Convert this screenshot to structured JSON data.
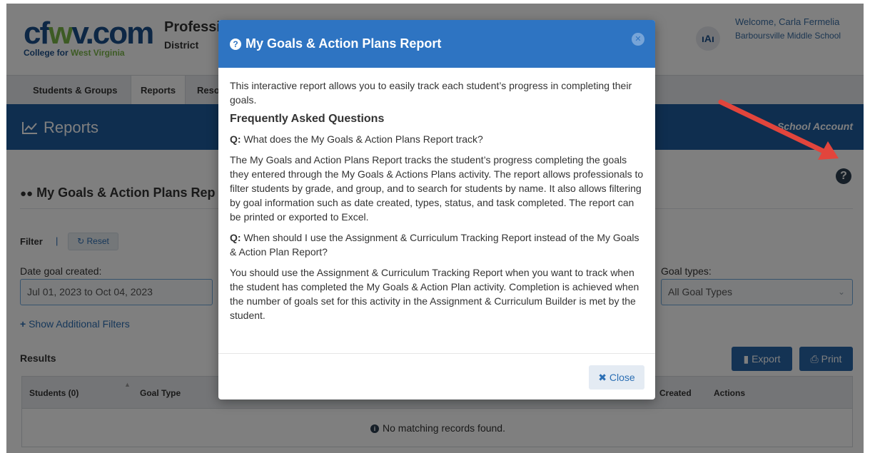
{
  "header": {
    "logo_main": "cfwv.com",
    "logo_sub": "College for West Virginia",
    "org_title": "Professi",
    "org_sub": "District",
    "user_initials": "ıAı",
    "welcome": "Welcome, Carla Fermelia",
    "school": "Barboursville Middle School"
  },
  "nav": {
    "items": [
      {
        "label": "Students & Groups"
      },
      {
        "label": "Reports"
      },
      {
        "label": "Reso"
      }
    ]
  },
  "banner": {
    "title": "Reports",
    "account": "School Account"
  },
  "section": {
    "title": "My Goals & Action Plans Rep"
  },
  "filters": {
    "label": "Filter",
    "separator": "|",
    "reset": "Reset",
    "date_label": "Date goal created:",
    "date_value": "Jul 01, 2023 to Oct 04, 2023",
    "goal_types_label": "Goal types:",
    "goal_types_value": "All Goal Types",
    "show_more": "Show Additional Filters"
  },
  "results": {
    "label": "Results",
    "export": "Export",
    "print": "Print",
    "columns": [
      "Students (0)",
      "Goal Type",
      "Created",
      "Actions"
    ],
    "empty": "No matching records found."
  },
  "modal": {
    "title": "My Goals & Action Plans Report",
    "intro": "This interactive report allows you to easily track each student’s progress in completing their goals.",
    "faq_heading": "Frequently Asked Questions",
    "q_prefix": "Q:",
    "q1": "What does the My Goals & Action Plans Report track?",
    "a1": "The My Goals and Action Plans Report tracks the student’s progress completing the goals they entered through the My Goals & Actions Plans activity. The report allows professionals to filter students by grade, and group, and to search for students by name. It also allows filtering by goal information such as date created, types, status, and task completed. The report can be printed or exported to Excel.",
    "q2": "When should I use the Assignment & Curriculum Tracking Report instead of the My Goals & Action Plan Report?",
    "a2": "You should use the Assignment & Curriculum Tracking Report when you want to track when the student has completed the My Goals & Action Plan activity. Completion is achieved when the number of goals set for this activity in the Assignment & Curriculum Builder is met by the student.",
    "close": "Close"
  },
  "colors": {
    "brand_blue": "#1f5c9e",
    "modal_header": "#2e74c2",
    "accent_green": "#7ab648",
    "arrow_red": "#e2453c"
  }
}
